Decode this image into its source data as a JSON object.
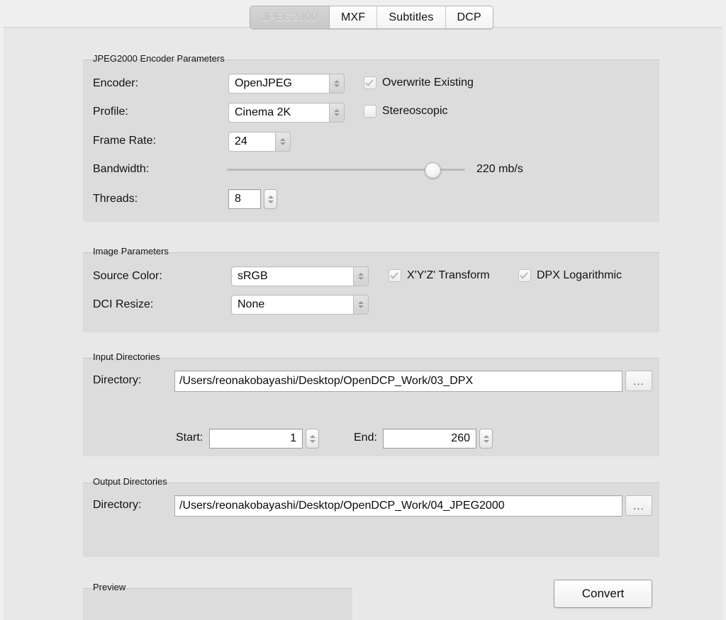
{
  "window": {
    "tabs": [
      {
        "label": "JPEG2000",
        "selected": true
      },
      {
        "label": "MXF",
        "selected": false
      },
      {
        "label": "Subtitles",
        "selected": false
      },
      {
        "label": "DCP",
        "selected": false
      }
    ]
  },
  "encoder_group": {
    "title": "JPEG2000 Encoder Parameters",
    "encoder_label": "Encoder:",
    "encoder_value": "OpenJPEG",
    "profile_label": "Profile:",
    "profile_value": "Cinema 2K",
    "frame_rate_label": "Frame Rate:",
    "frame_rate_value": "24",
    "bandwidth_label": "Bandwidth:",
    "bandwidth_value": "220 mb/s",
    "bandwidth_percent": 86,
    "threads_label": "Threads:",
    "threads_value": "8",
    "overwrite_label": "Overwrite Existing",
    "overwrite_checked": true,
    "stereoscopic_label": "Stereoscopic",
    "stereoscopic_checked": false
  },
  "image_group": {
    "title": "Image Parameters",
    "source_color_label": "Source Color:",
    "source_color_value": "sRGB",
    "dci_resize_label": "DCI Resize:",
    "dci_resize_value": "None",
    "xyz_label": "X'Y'Z' Transform",
    "xyz_checked": true,
    "dpx_log_label": "DPX Logarithmic",
    "dpx_log_checked": true
  },
  "input_group": {
    "title": "Input Directories",
    "directory_label": "Directory:",
    "directory_value": "/Users/reonakobayashi/Desktop/OpenDCP_Work/03_DPX",
    "browse_label": "...",
    "start_label": "Start:",
    "start_value": "1",
    "end_label": "End:",
    "end_value": "260"
  },
  "output_group": {
    "title": "Output Directories",
    "directory_label": "Directory:",
    "directory_value": "/Users/reonakobayashi/Desktop/OpenDCP_Work/04_JPEG2000",
    "browse_label": "..."
  },
  "preview_group": {
    "title": "Preview"
  },
  "actions": {
    "convert_label": "Convert"
  },
  "colors": {
    "window_bg": "#efeff0",
    "content_bg": "#e8e8e8",
    "panel_bg": "#dcdcdc",
    "field_bg": "#ffffff",
    "text": "#121212"
  }
}
